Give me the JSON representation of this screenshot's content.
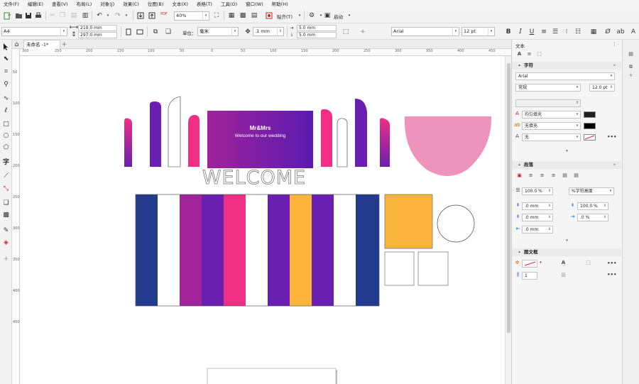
{
  "menu": [
    "文件(F)",
    "编辑(E)",
    "查看(V)",
    "布局(L)",
    "对象(J)",
    "效果(C)",
    "位图(B)",
    "文本(X)",
    "表格(T)",
    "工具(O)",
    "窗口(W)",
    "帮助(H)"
  ],
  "toolbar1": {
    "zoom": "40%",
    "paste_label": "贴齐(T)",
    "launch_label": "启动",
    "pdf_label": "PDF"
  },
  "toolbar2": {
    "page_size": "A4",
    "width": "210.0 mm",
    "height": "297.0 mm",
    "units_label": "单位：",
    "units_value": "毫米",
    "nudge": ".1 mm",
    "dup_x": "5.0 mm",
    "dup_y": "5.0 mm",
    "font": "Arial",
    "font_size": "12 pt"
  },
  "tab": {
    "doc_name": "未命名 -1*",
    "add": "+"
  },
  "ruler": {
    "h": [
      "300",
      "250",
      "200",
      "150",
      "100",
      "50",
      "0",
      "50",
      "100",
      "150",
      "200",
      "250",
      "300",
      "350",
      "400",
      "450"
    ],
    "v": [
      "50",
      "100",
      "150",
      "200",
      "250",
      "300",
      "350",
      "400",
      "450"
    ]
  },
  "canvas": {
    "banner_title": "Mr&Mrs",
    "banner_subtitle": "Welcome to our wedding",
    "welcome": "WELCOME"
  },
  "panel": {
    "title": "文本",
    "char_section": "字符",
    "font": "Arial",
    "style": "常规",
    "size": "12.0 pt",
    "fill1": "均匀填充",
    "fill2": "无填充",
    "fill3": "无",
    "para_section": "段落",
    "line_spacing": "100.0 %",
    "spacing_mode": "%字符高度",
    "before": ".0 mm",
    "after": ".0 mm",
    "indent": ".0 mm",
    "char_spacing": "100.0 %",
    "word_spacing": ".0 %",
    "frame_section": "图文框",
    "columns": "1"
  },
  "colors": {
    "navy": "#233b8c",
    "magenta": "#a0239a",
    "purple": "#6a1fb0",
    "pink": "#ee2f83",
    "orange": "#fbb53d",
    "light_pink": "#ee93bb"
  }
}
